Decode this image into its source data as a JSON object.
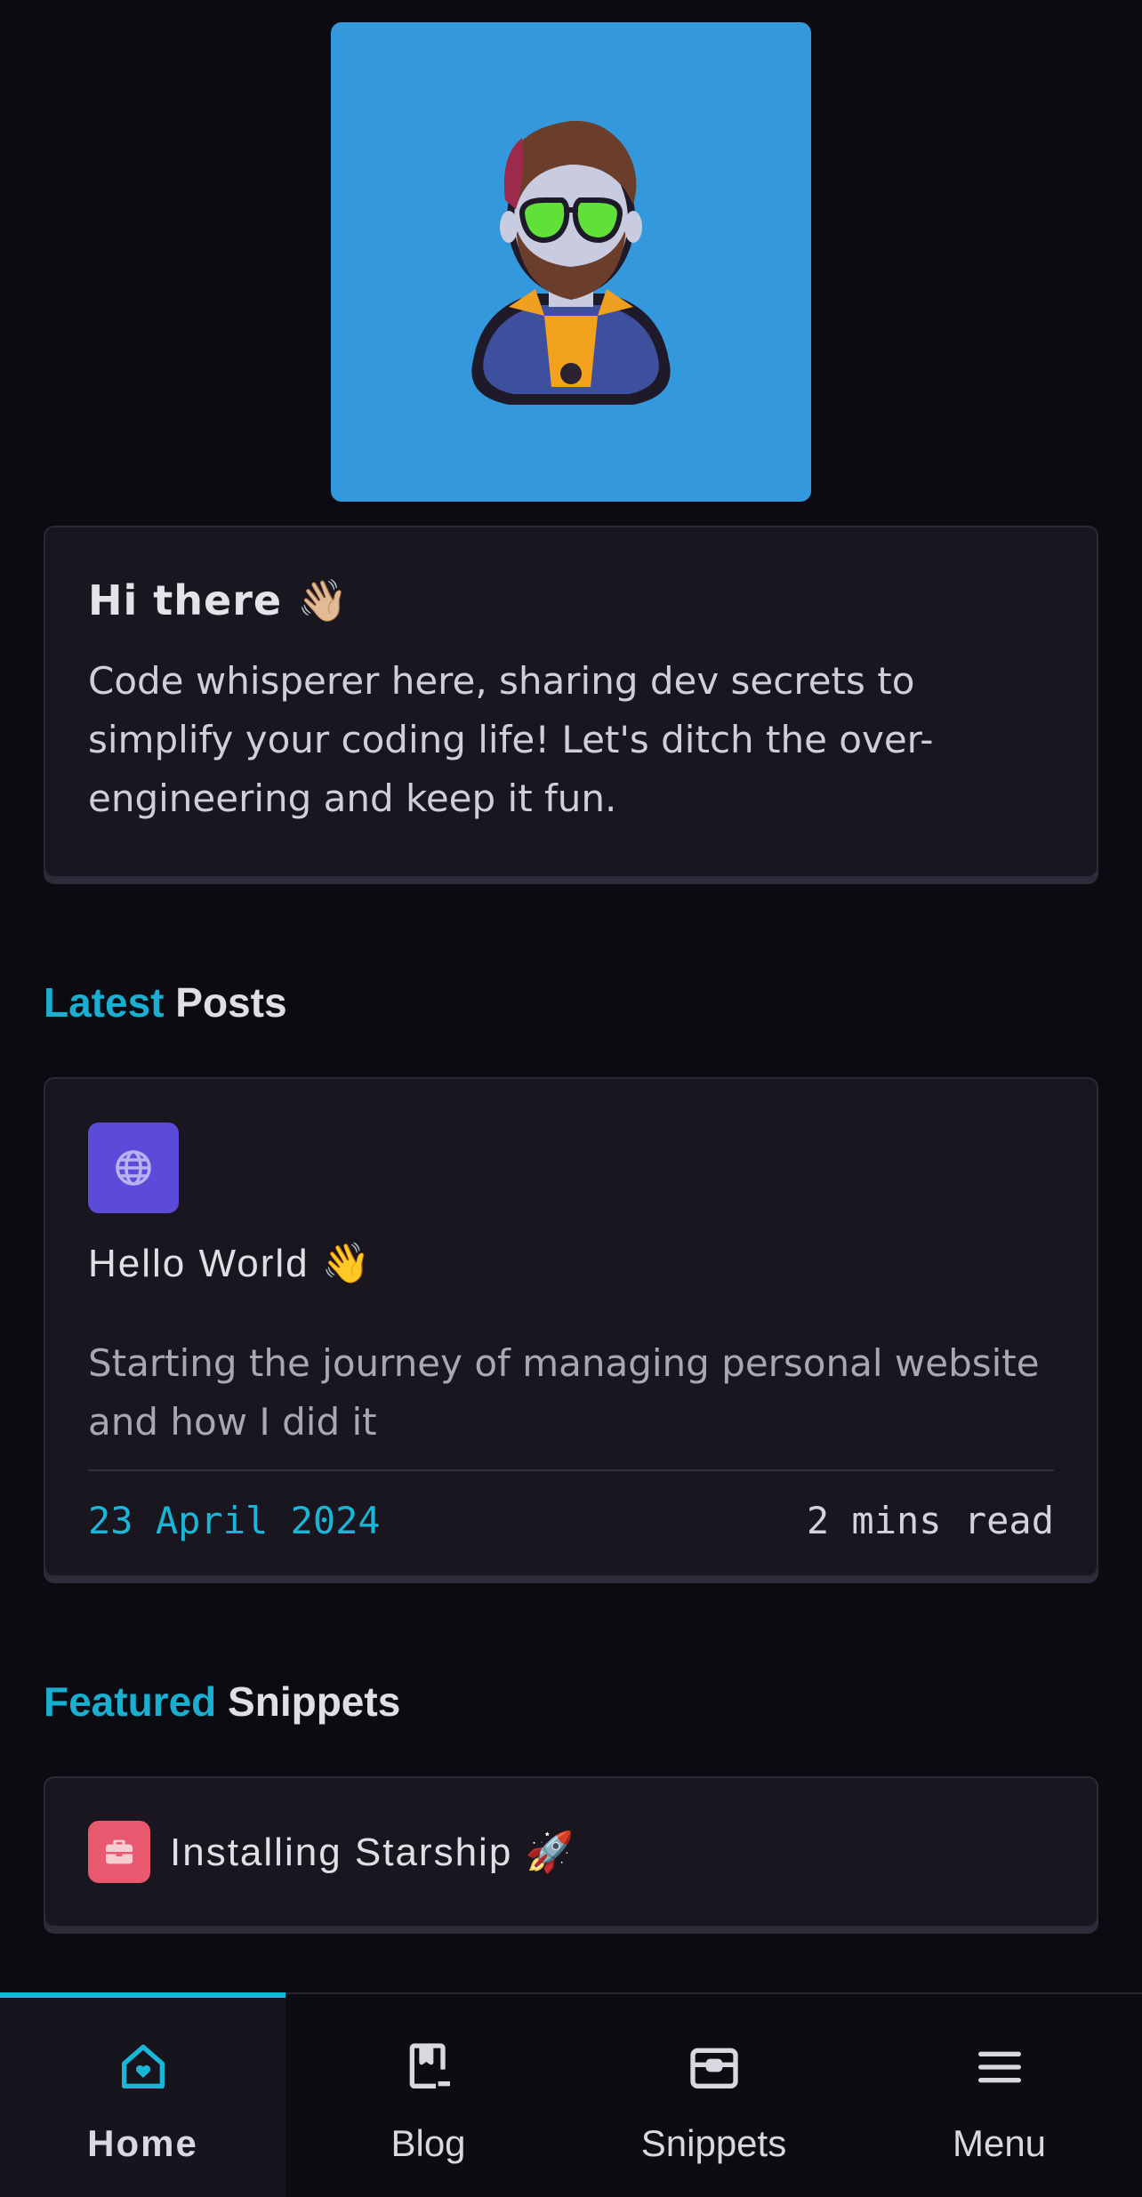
{
  "intro": {
    "title": "Hi there 👋🏼",
    "text": "Code whisperer here, sharing dev secrets to simplify your coding life! Let's ditch the over-engineering and keep it fun."
  },
  "latest_heading": {
    "accent": "Latest",
    "rest": "Posts"
  },
  "post": {
    "icon": "globe-icon",
    "title": "Hello World 👋",
    "description": "Starting the journey of managing personal website and how I did it",
    "date": "23 April 2024",
    "read_time": "2 mins read"
  },
  "featured_heading": {
    "accent": "Featured",
    "rest": "Snippets"
  },
  "snippet": {
    "icon": "toolbox-icon",
    "title": "Installing Starship 🚀"
  },
  "nav": {
    "items": [
      {
        "label": "Home",
        "icon": "home-heart-icon",
        "active": true
      },
      {
        "label": "Blog",
        "icon": "bookmark-icon",
        "active": false
      },
      {
        "label": "Snippets",
        "icon": "archive-box-icon",
        "active": false
      },
      {
        "label": "Menu",
        "icon": "menu-icon",
        "active": false
      }
    ]
  },
  "colors": {
    "background": "#0c0b11",
    "card": "#19161f",
    "accent": "#1aaed1",
    "avatar_bg": "#3499dc",
    "post_icon_bg": "#5b4bd8",
    "snippet_icon_bg": "#e8586f"
  }
}
